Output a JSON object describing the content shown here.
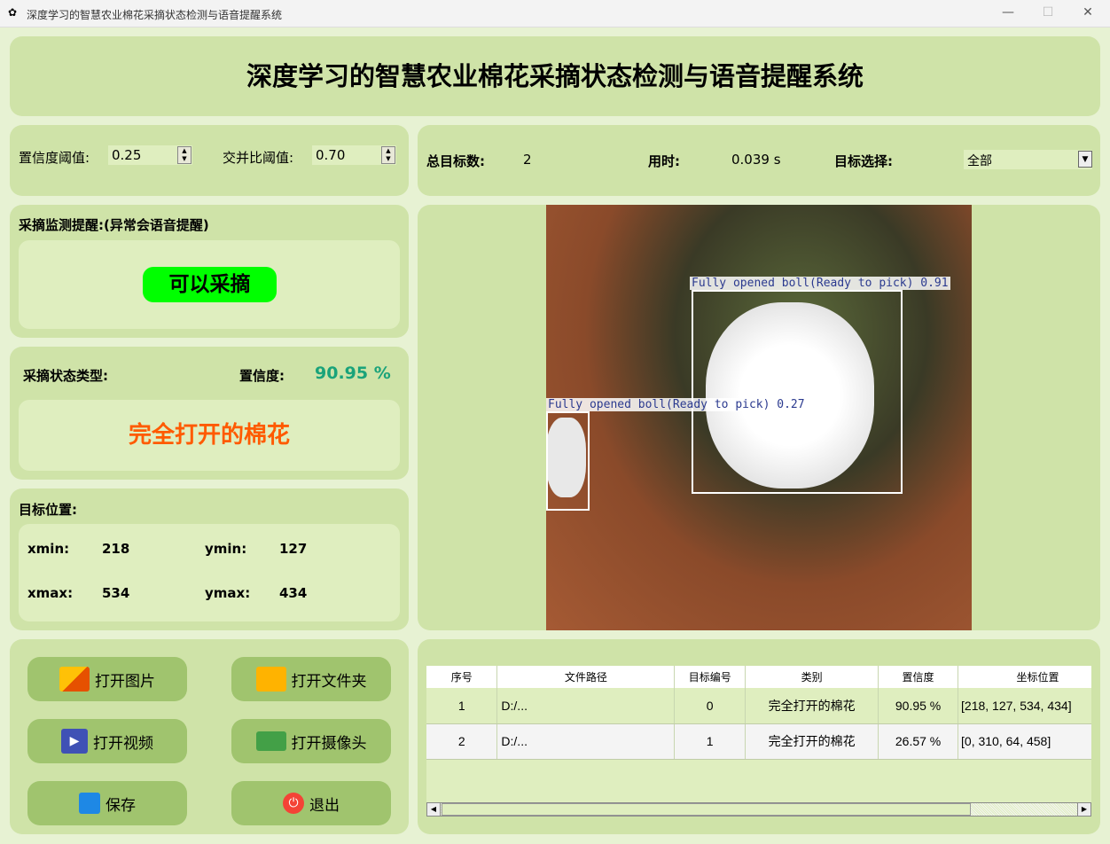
{
  "window": {
    "title": "深度学习的智慧农业棉花采摘状态检测与语音提醒系统",
    "minimize": "—",
    "maximize": "☐",
    "close": "✕"
  },
  "header": {
    "title": "深度学习的智慧农业棉花采摘状态检测与语音提醒系统"
  },
  "params": {
    "conf_label": "置信度阈值:",
    "conf_value": "0.25",
    "iou_label": "交并比阈值:",
    "iou_value": "0.70"
  },
  "stats": {
    "total_label": "总目标数:",
    "total_value": "2",
    "time_label": "用时:",
    "time_value": "0.039 s",
    "select_label": "目标选择:",
    "select_value": "全部"
  },
  "reminder": {
    "title": "采摘监测提醒:(异常会语音提醒)",
    "status": "可以采摘",
    "status_color": "#00ff00"
  },
  "result": {
    "type_label": "采摘状态类型:",
    "conf_label": "置信度:",
    "conf_value": "90.95 %",
    "type_value": "完全打开的棉花",
    "type_color": "#ff5a00",
    "conf_color": "#1aa37a"
  },
  "position": {
    "title": "目标位置:",
    "xmin_label": "xmin:",
    "xmin": "218",
    "ymin_label": "ymin:",
    "ymin": "127",
    "xmax_label": "xmax:",
    "xmax": "534",
    "ymax_label": "ymax:",
    "ymax": "434"
  },
  "detections": [
    {
      "label": "Fully opened boll(Ready to pick) 0.91"
    },
    {
      "label": "Fully opened boll(Ready to pick) 0.27"
    }
  ],
  "buttons": {
    "open_image": "打开图片",
    "open_folder": "打开文件夹",
    "open_video": "打开视频",
    "open_camera": "打开摄像头",
    "save": "保存",
    "exit": "退出"
  },
  "table": {
    "headers": [
      "序号",
      "文件路径",
      "目标编号",
      "类别",
      "置信度",
      "坐标位置"
    ],
    "rows": [
      [
        "1",
        "D:/...",
        "0",
        "完全打开的棉花",
        "90.95 %",
        "[218, 127, 534, 434]"
      ],
      [
        "2",
        "D:/...",
        "1",
        "完全打开的棉花",
        "26.57 %",
        "[0, 310, 64, 458]"
      ]
    ]
  }
}
